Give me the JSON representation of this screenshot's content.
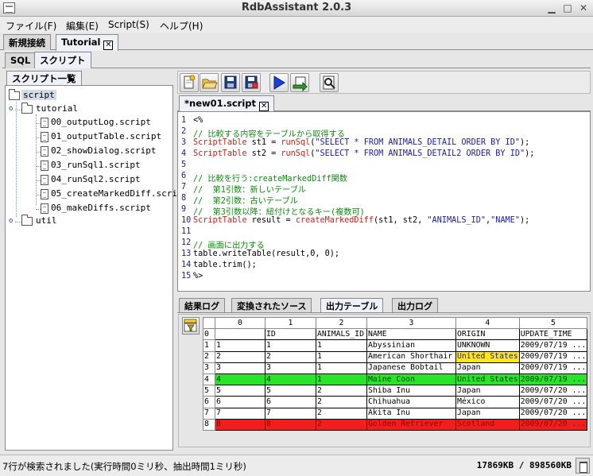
{
  "window": {
    "title": "RdbAssistant 2.0.3"
  },
  "menu": [
    "ファイル(F)",
    "編集(E)",
    "Script(S)",
    "ヘルプ(H)"
  ],
  "doc_tabs": [
    "新規接続",
    "Tutorial"
  ],
  "sub_tabs": [
    "SQL",
    "スクリプト"
  ],
  "tree": {
    "header": "スクリプト一覧",
    "root": "script",
    "folder1": "tutorial",
    "files": [
      "00_outputLog.script",
      "01_outputTable.script",
      "02_showDialog.script",
      "03_runSql1.script",
      "04_runSql2.script",
      "05_createMarkedDiff.script",
      "06_makeDiffs.script"
    ],
    "folder2": "util"
  },
  "editor": {
    "tab": "*new01.script",
    "lines": [
      {
        "n": "1",
        "t": "<%"
      },
      {
        "n": "2",
        "t": "// 比較する内容をテーブルから取得する"
      },
      {
        "n": "3",
        "t": "ScriptTable st1 = runSql(\"SELECT * FROM ANIMALS_DETAIL ORDER BY ID\");"
      },
      {
        "n": "4",
        "t": "ScriptTable st2 = runSql(\"SELECT * FROM ANIMALS_DETAIL2 ORDER BY ID\");"
      },
      {
        "n": "5",
        "t": ""
      },
      {
        "n": "6",
        "t": "// 比較を行う:createMarkedDiff関数"
      },
      {
        "n": "7",
        "t": "//  第1引数：新しいテーブル"
      },
      {
        "n": "8",
        "t": "//  第2引数：古いテーブル"
      },
      {
        "n": "9",
        "t": "//  第3引数以降：紐付けとなるキー(複数可)"
      },
      {
        "n": "10",
        "t": "ScriptTable result = createMarkedDiff(st1, st2, \"ANIMALS_ID\",\"NAME\");"
      },
      {
        "n": "11",
        "t": ""
      },
      {
        "n": "12",
        "t": "// 画面に出力する"
      },
      {
        "n": "13",
        "t": "table.writeTable(result,0, 0);"
      },
      {
        "n": "14",
        "t": "table.trim();"
      },
      {
        "n": "15",
        "t": "%>"
      }
    ]
  },
  "result_tabs": [
    "結果ログ",
    "変換されたソース",
    "出力テーブル",
    "出力ログ"
  ],
  "table": {
    "col_headers": [
      "0",
      "1",
      "2",
      "3",
      "4",
      "5"
    ],
    "row_nums": [
      "0",
      "1",
      "2",
      "3",
      "4",
      "5",
      "6",
      "7",
      "8"
    ],
    "rows": [
      [
        "",
        "ID",
        "ANIMALS_ID",
        "NAME",
        "ORIGIN",
        "UPDATE_TIME"
      ],
      [
        "1",
        "1",
        "1",
        "Abyssinian",
        "UNKNOWN",
        "2009/07/19 ..."
      ],
      [
        "2",
        "2",
        "1",
        "American Shorthair",
        "United States",
        "2009/07/19 ..."
      ],
      [
        "3",
        "3",
        "1",
        "Japanese Bobtail",
        "Japan",
        "2009/07/19 ..."
      ],
      [
        "4",
        "4",
        "1",
        "Maine Coon",
        "United States",
        "2009/07/19 ..."
      ],
      [
        "5",
        "5",
        "2",
        "Shiba Inu",
        "Japan",
        "2009/07/20 ..."
      ],
      [
        "6",
        "6",
        "2",
        "Chihuahua",
        "México",
        "2009/07/20 ..."
      ],
      [
        "7",
        "7",
        "2",
        "Akita Inu",
        "Japan",
        "2009/07/20 ..."
      ],
      [
        "8",
        "8",
        "2",
        "Golden Retriever",
        "Scotland",
        "2009/07/20 ..."
      ]
    ],
    "green_row": 4,
    "red_row": 8,
    "yellow_cell": {
      "row": 2,
      "col": 4
    }
  },
  "status": {
    "message": "7行が検索されました(実行時間0ミリ秒、抽出時間1ミリ秒)",
    "memory": "17869KB / 898560KB"
  },
  "colors": {
    "green": "#29e52a",
    "red": "#f21d1d",
    "yellow": "#ffe71a",
    "comment": "#108a10",
    "keyword": "#c3261f",
    "string": "#1a1aa6"
  }
}
